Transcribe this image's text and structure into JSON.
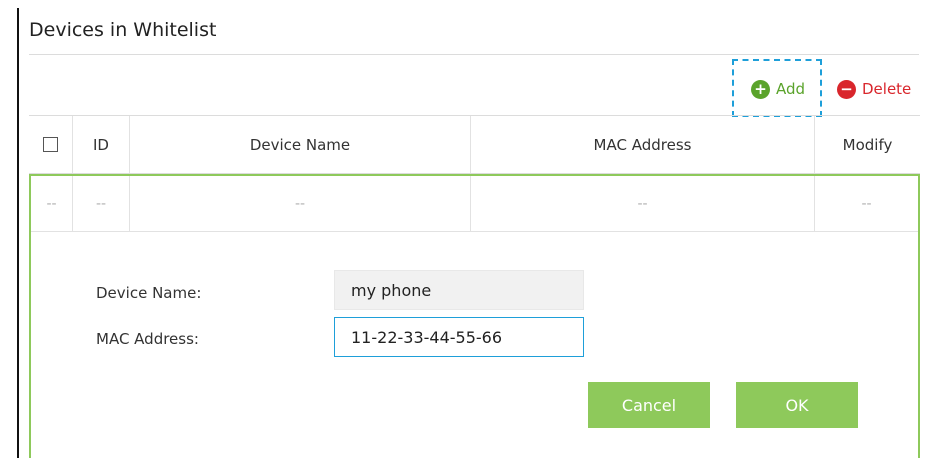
{
  "panel": {
    "title": "Devices in Whitelist"
  },
  "toolbar": {
    "add_label": "Add",
    "delete_label": "Delete",
    "add_icon": "plus-circle-icon",
    "delete_icon": "minus-circle-icon"
  },
  "table": {
    "columns": [
      "ID",
      "Device Name",
      "MAC Address",
      "Modify"
    ],
    "rows": [
      [
        "--",
        "--",
        "--",
        "--",
        "--"
      ]
    ]
  },
  "form": {
    "device_name_label": "Device Name:",
    "device_name_value": "my phone",
    "mac_address_label": "MAC Address:",
    "mac_address_value": "11-22-33-44-55-66",
    "cancel_label": "Cancel",
    "ok_label": "OK"
  },
  "colors": {
    "accent_green": "#8ec95b",
    "add_green": "#5aa32b",
    "delete_red": "#d9262c",
    "focus_blue": "#1e9fd9"
  }
}
